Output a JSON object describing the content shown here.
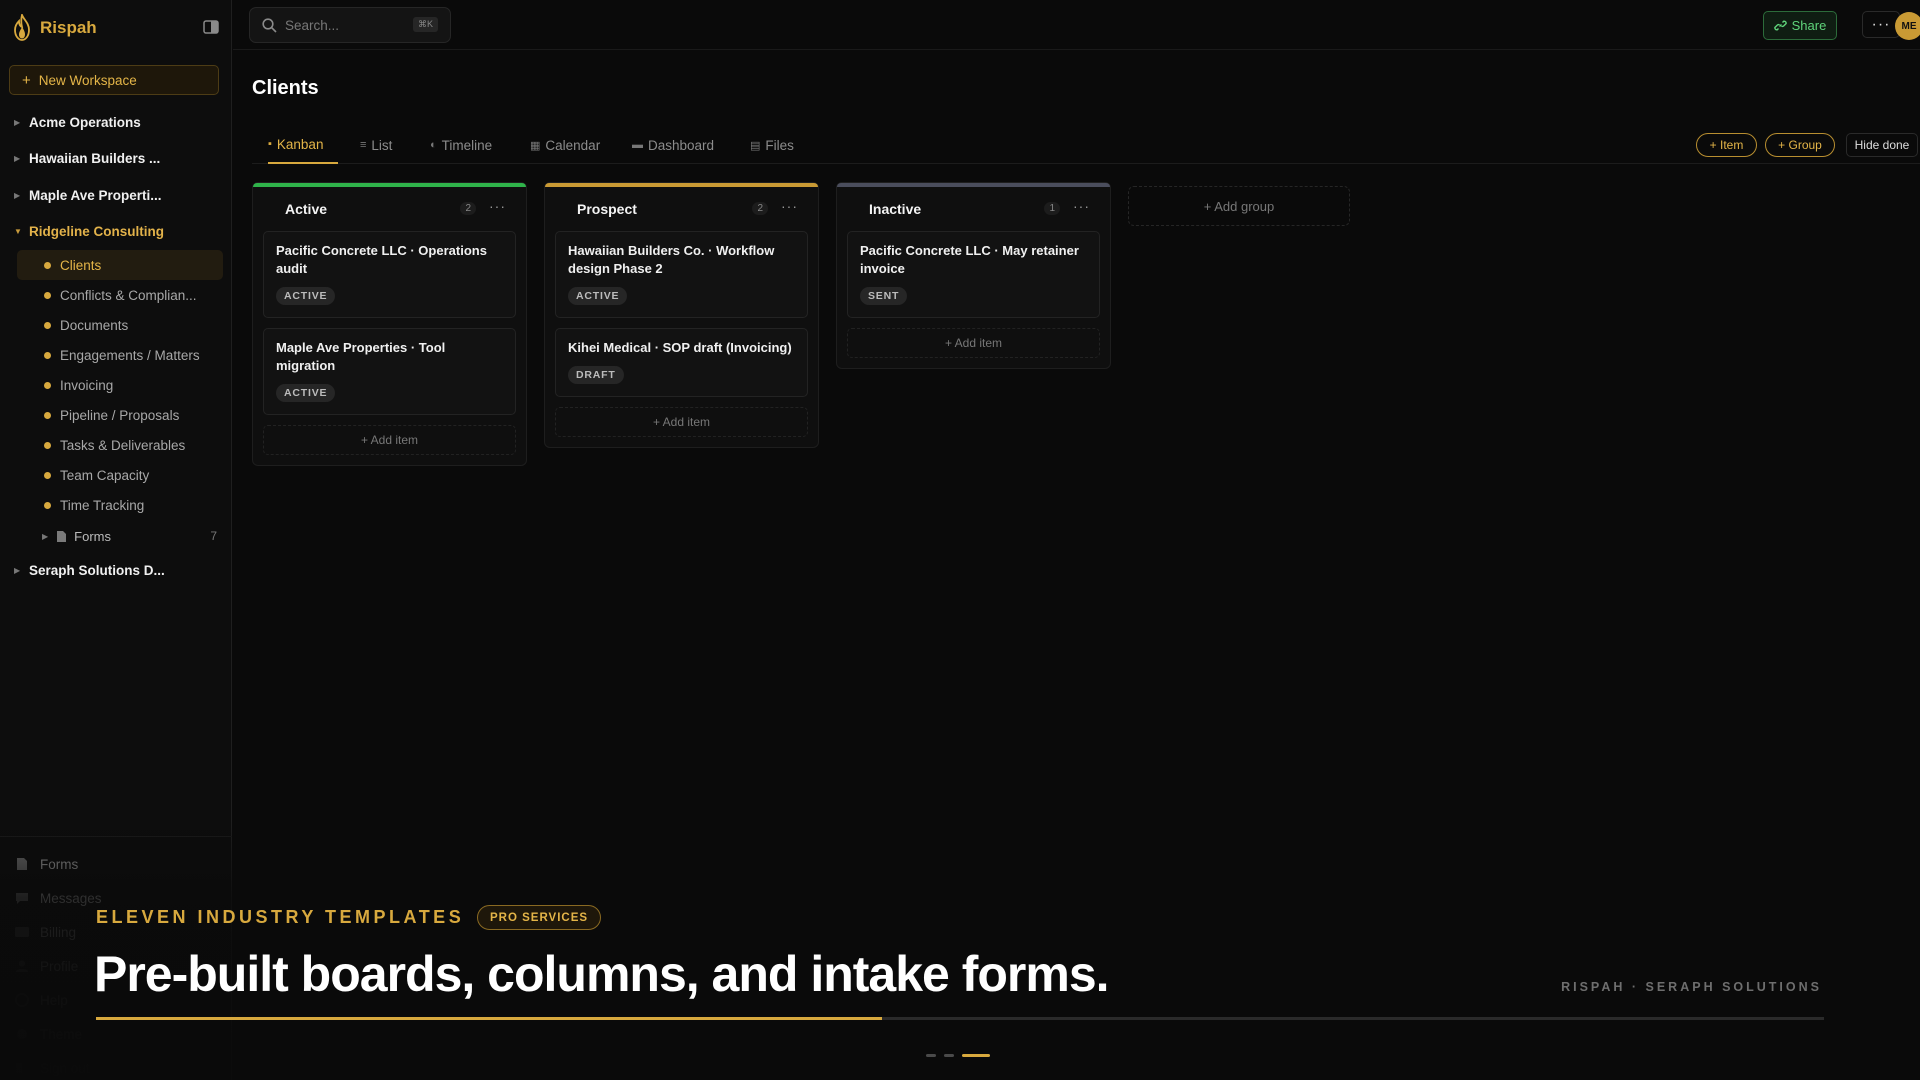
{
  "brand": {
    "name": "Rispah"
  },
  "sidebar": {
    "new_workspace_label": "New Workspace",
    "workspaces": [
      {
        "label": "Acme Operations"
      },
      {
        "label": "Hawaiian Builders ..."
      },
      {
        "label": "Maple Ave Properti..."
      },
      {
        "label": "Ridgeline Consulting"
      },
      {
        "label": "Seraph Solutions D..."
      }
    ],
    "open_workspace_items": [
      {
        "label": "Clients"
      },
      {
        "label": "Conflicts & Complian..."
      },
      {
        "label": "Documents"
      },
      {
        "label": "Engagements / Matters"
      },
      {
        "label": "Invoicing"
      },
      {
        "label": "Pipeline / Proposals"
      },
      {
        "label": "Tasks & Deliverables"
      },
      {
        "label": "Team Capacity"
      },
      {
        "label": "Time Tracking"
      }
    ],
    "forms_folder": {
      "label": "Forms",
      "count": "7"
    },
    "bottom_items": [
      {
        "label": "Forms"
      },
      {
        "label": "Messages"
      },
      {
        "label": "Billing"
      },
      {
        "label": "Profile"
      },
      {
        "label": "Help"
      },
      {
        "label": "Theme"
      },
      {
        "label": "Sign out"
      }
    ]
  },
  "topbar": {
    "search_placeholder": "Search...",
    "search_shortcut": "⌘K",
    "share_label": "Share",
    "more_label": "···",
    "avatar_initials": "ME"
  },
  "page": {
    "title": "Clients"
  },
  "tabs": [
    {
      "label": "Kanban",
      "icon": "▪"
    },
    {
      "label": "List",
      "icon": "≡"
    },
    {
      "label": "Timeline",
      "icon": "◐"
    },
    {
      "label": "Calendar",
      "icon": "▦"
    },
    {
      "label": "Dashboard",
      "icon": "▬"
    },
    {
      "label": "Files",
      "icon": "▤"
    }
  ],
  "actions": {
    "item_label": "+ Item",
    "group_label": "+ Group",
    "hide_done_label": "Hide done"
  },
  "columns": [
    {
      "title": "Active",
      "count": "2",
      "color": "#2fb34a",
      "cards": [
        {
          "title": "Pacific Concrete LLC · Operations audit",
          "badge": "ACTIVE"
        },
        {
          "title": "Maple Ave Properties · Tool migration",
          "badge": "ACTIVE"
        }
      ]
    },
    {
      "title": "Prospect",
      "count": "2",
      "color": "#c99a34",
      "cards": [
        {
          "title": "Hawaiian Builders Co. · Workflow design Phase 2",
          "badge": "ACTIVE"
        },
        {
          "title": "Kihei Medical · SOP draft (Invoicing)",
          "badge": "DRAFT"
        }
      ]
    },
    {
      "title": "Inactive",
      "count": "1",
      "color": "#4a4d5c",
      "cards": [
        {
          "title": "Pacific Concrete LLC · May retainer invoice",
          "badge": "SENT"
        }
      ]
    }
  ],
  "add_item_label": "+ Add item",
  "add_group_label": "+ Add group",
  "overlay": {
    "eyebrow": "ELEVEN INDUSTRY TEMPLATES",
    "badge": "PRO SERVICES",
    "headline": "Pre-built boards, columns, and intake forms.",
    "credit": "RISPAH · SERAPH SOLUTIONS",
    "progress": 0.455,
    "slides": 3,
    "current_slide": 3
  },
  "colors": {
    "accent": "#d8a93e",
    "share_green": "#5fd47a"
  }
}
